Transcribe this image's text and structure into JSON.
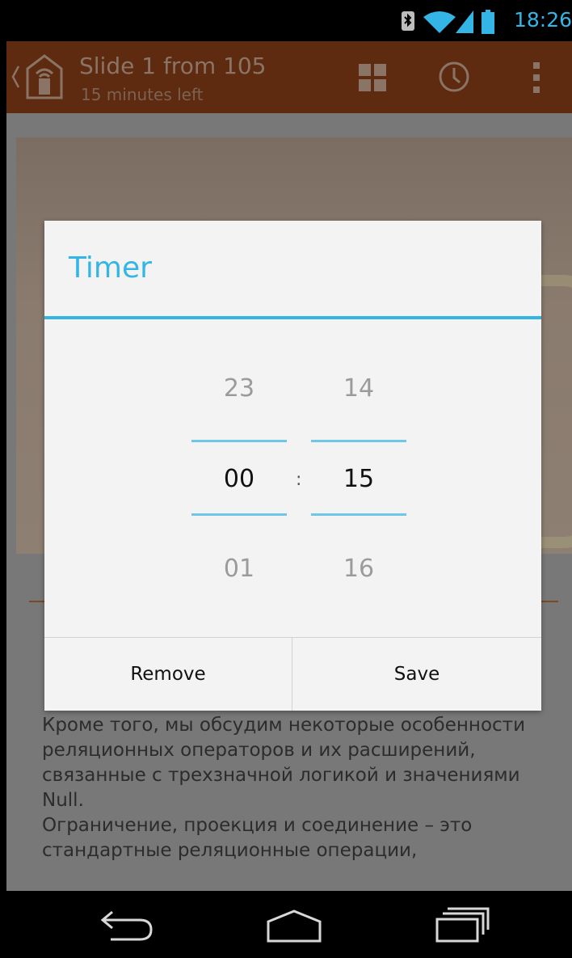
{
  "status_bar": {
    "time": "18:26",
    "accent_color": "#33b5e5"
  },
  "action_bar": {
    "title": "Slide 1 from 105",
    "subtitle": "15 minutes left",
    "background_color": "#5e2b10"
  },
  "content": {
    "paragraph_lines": [
      "Кроме того, мы обсудим некоторые особенности",
      "реляционных операторов и их расширений,",
      "связанные с трехзначной логикой и значениями",
      "Null.",
      "Ограничение, проекция и соединение – это",
      "стандартные реляционные операции,"
    ]
  },
  "dialog": {
    "title": "Timer",
    "accent_color": "#33b5e5",
    "hours": {
      "previous": "23",
      "current": "00",
      "next": "01"
    },
    "separator": ":",
    "minutes": {
      "previous": "14",
      "current": "15",
      "next": "16"
    },
    "remove_label": "Remove",
    "save_label": "Save"
  },
  "icons": {
    "status": [
      "bluetooth-icon",
      "wifi-icon",
      "signal-icon",
      "battery-icon"
    ],
    "action_bar": [
      "back-chevron-icon",
      "app-remote-icon",
      "grid-icon",
      "clock-icon",
      "overflow-menu-icon"
    ],
    "nav": [
      "back-icon",
      "home-icon",
      "recent-apps-icon"
    ]
  }
}
